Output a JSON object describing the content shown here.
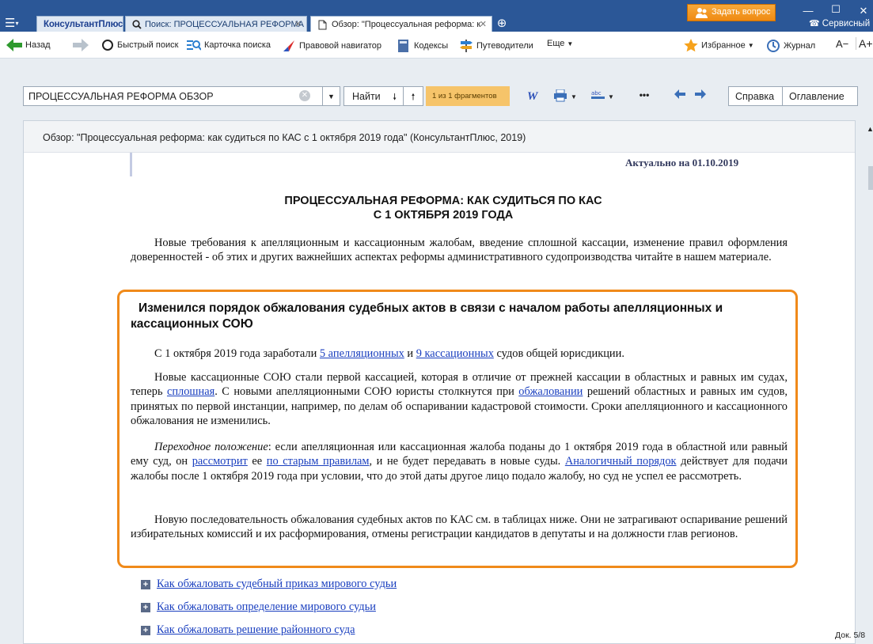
{
  "window": {
    "ask_question": "Задать вопрос",
    "service_center": "Сервисный цент"
  },
  "tabs": [
    {
      "label": "КонсультантПлюс"
    },
    {
      "label": "Поиск: ПРОЦЕССУАЛЬНАЯ РЕФОРМА"
    },
    {
      "label": "Обзор: \"Процессуальная реформа: к"
    }
  ],
  "toolbar": {
    "back": "Назад",
    "quick_search": "Быстрый поиск",
    "search_card": "Карточка поиска",
    "legal_navigator": "Правовой навигатор",
    "codes": "Кодексы",
    "guides": "Путеводители",
    "more": "Еще",
    "favorites": "Избранное",
    "journal": "Журнал",
    "font_minus": "A−",
    "font_plus": "A+"
  },
  "search": {
    "value": "ПРОЦЕССУАЛЬНАЯ РЕФОРМА ОБЗОР",
    "find_label": "Найти",
    "fragments": "1 из 1 фрагментов",
    "help": "Справка",
    "contents": "Оглавление"
  },
  "document": {
    "header": "Обзор: \"Процессуальная реформа: как судиться по КАС с 1 октября 2019 года\" (КонсультантПлюс, 2019)",
    "actual": "Актуально на 01.10.2019",
    "title_line1": "ПРОЦЕССУАЛЬНАЯ РЕФОРМА: КАК СУДИТЬСЯ ПО КАС",
    "title_line2": "С 1 ОКТЯБРЯ 2019 ГОДА",
    "intro": "Новые требования к апелляционным и кассационным жалобам, введение сплошной кассации, изменение правил оформления доверенностей - об этих и других важнейших аспектах реформы административного судопроизводства читайте в нашем материале.",
    "section_title": "Изменился порядок обжалования судебных актов в связи с началом работы апелляционных и кассационных СОЮ",
    "p1_a": "С 1 октября 2019 года заработали ",
    "p1_link1": "5 апелляционных",
    "p1_b": " и ",
    "p1_link2": "9 кассационных",
    "p1_c": " судов общей юрисдикции.",
    "p2_a": "Новые кассационные СОЮ стали первой кассацией, которая в отличие от прежней кассации в областных и равных им судах, теперь ",
    "p2_link1": "сплошная",
    "p2_b": ". С новыми апелляционными СОЮ юристы столкнутся при ",
    "p2_link2": "обжаловании",
    "p2_c": " решений областных и равных им судов, принятых по первой инстанции, например, по делам об оспаривании кадастровой стоимости. Сроки апелляционного и кассационного обжалования не изменились.",
    "p3_italic": "Переходное положение",
    "p3_a": ": если апелляционная или кассационная жалоба поданы до 1 октября 2019 года в областной или равный ему суд, он ",
    "p3_link1": "рассмотрит",
    "p3_b": " ее ",
    "p3_link2": "по старым правилам",
    "p3_c": ", и не будет передавать в новые суды. ",
    "p3_link3": "Аналогичный порядок",
    "p3_d": " действует для подачи жалобы после 1 октября 2019 года при условии, что до этой даты другое лицо подало жалобу, но суд не успел ее рассмотреть.",
    "p4": "Новую последовательность обжалования судебных актов по КАС см. в таблицах ниже. Они не затрагивают оспаривание решений избирательных комиссий и их расформирования, отмены регистрации кандидатов в депутаты и на должности глав регионов.",
    "toc": [
      "Как обжаловать судебный приказ мирового судьи",
      "Как обжаловать определение мирового судьи",
      "Как обжаловать решение районного суда"
    ],
    "doc_counter": "Док. 5/8"
  },
  "colors": {
    "titlebar": "#2b5797",
    "highlight": "#f08a1a",
    "link": "#1a3fbf"
  }
}
